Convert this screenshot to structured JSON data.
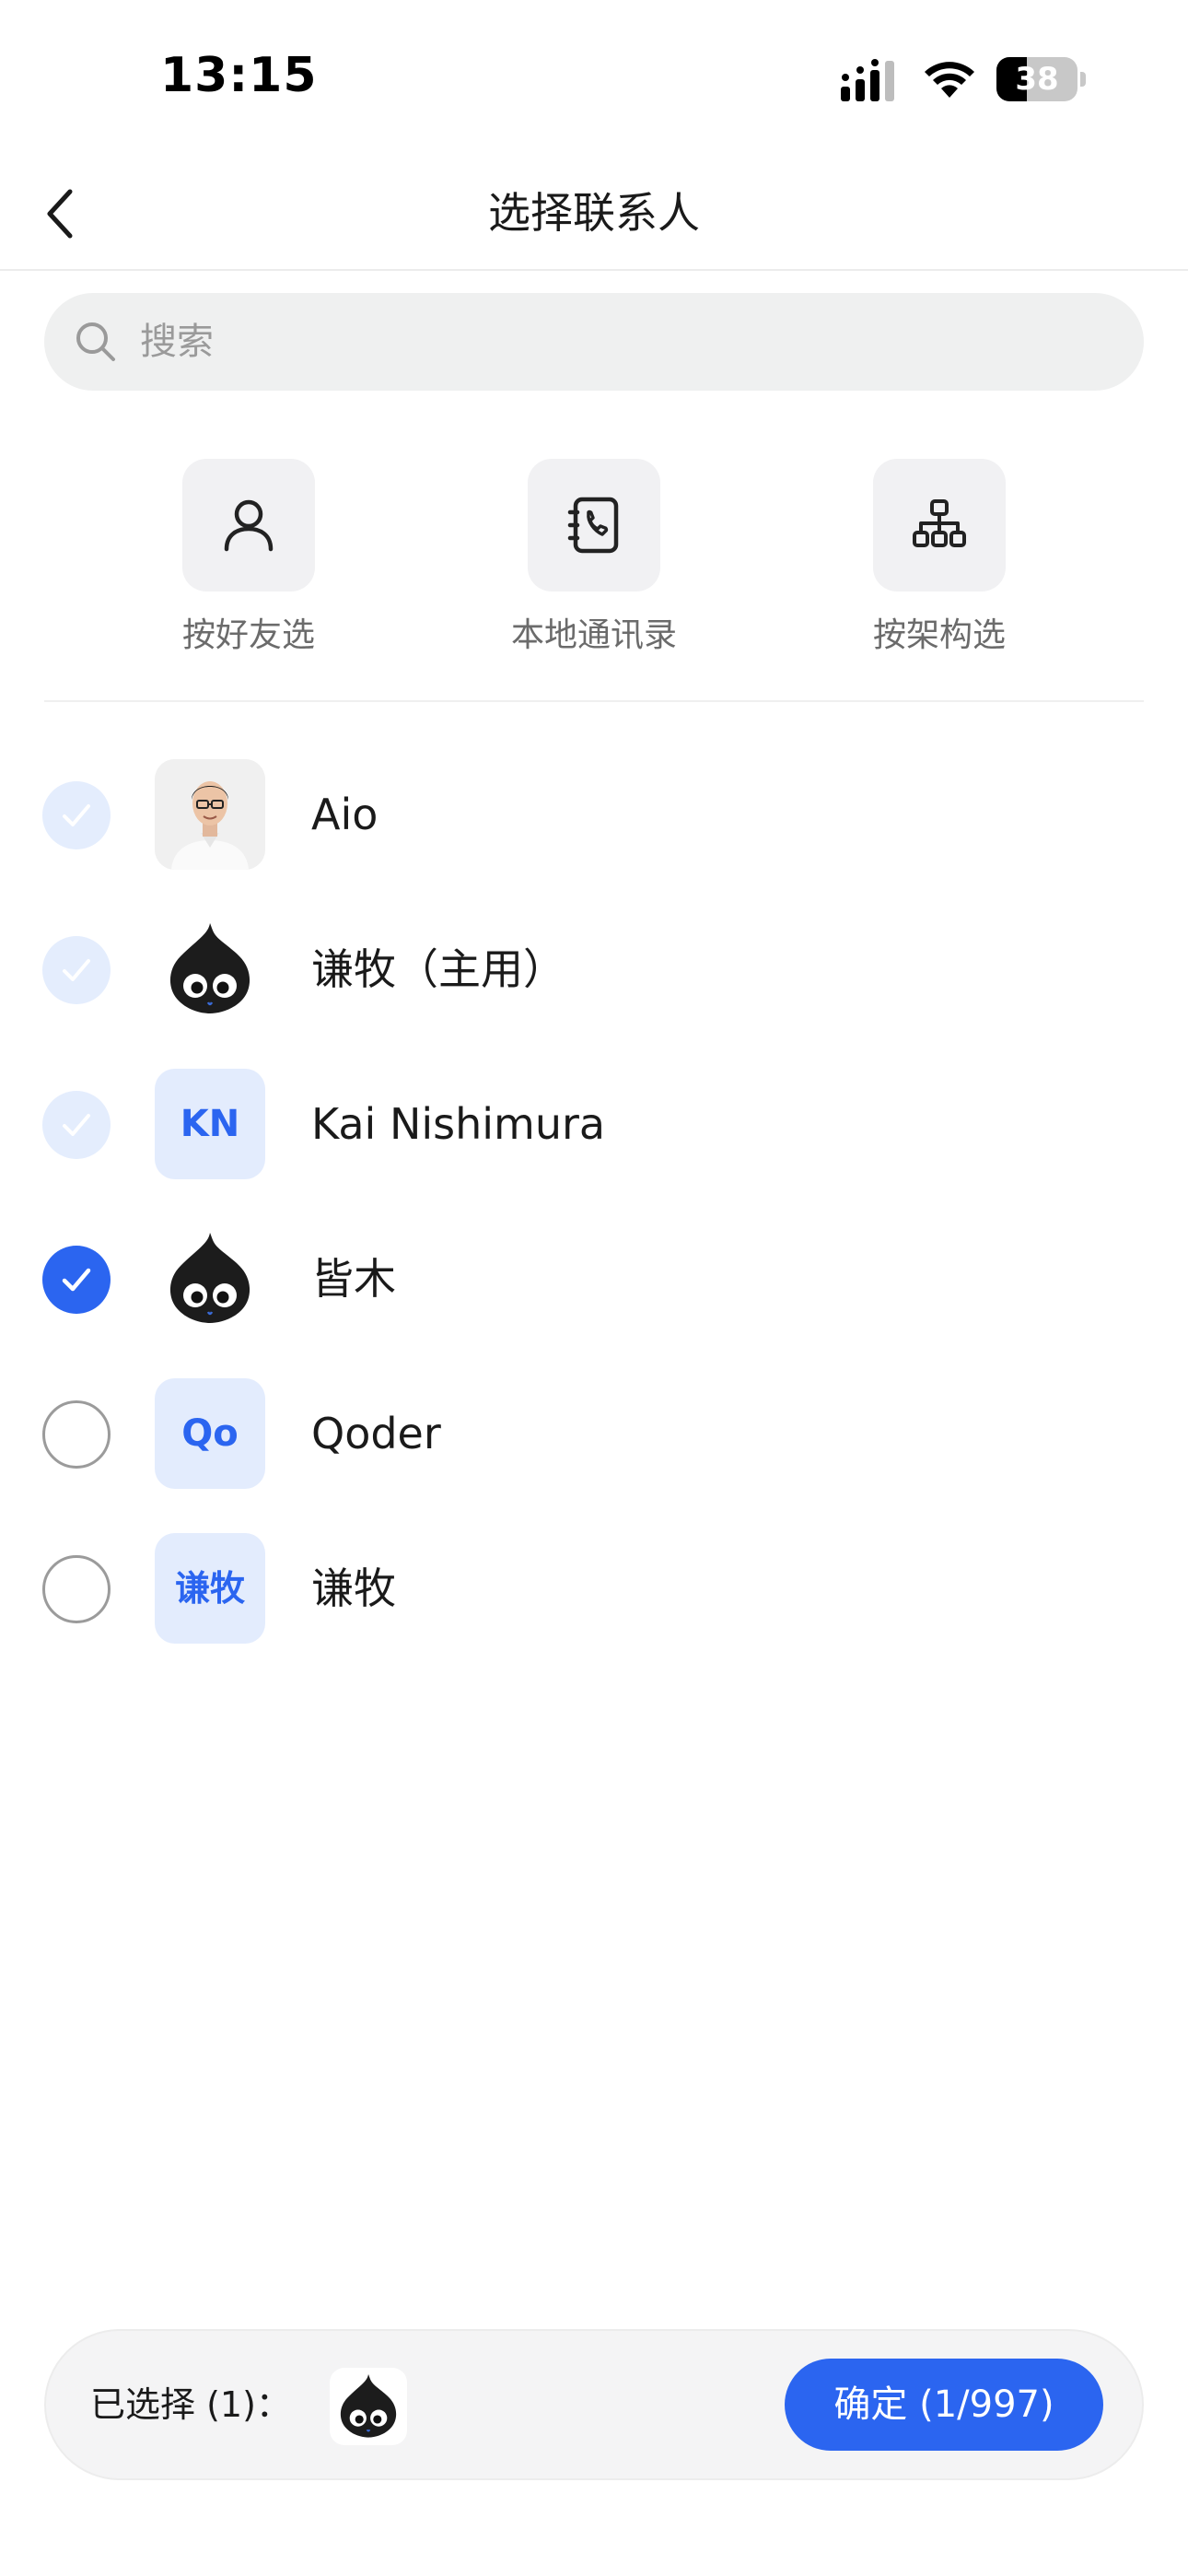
{
  "status_bar": {
    "time": "13:15",
    "battery_level": "38",
    "battery_fraction": 0.38
  },
  "nav": {
    "title": "选择联系人",
    "back_icon": "chevron-left-icon"
  },
  "search": {
    "placeholder": "搜索",
    "value": ""
  },
  "quick_select": [
    {
      "label": "按好友选",
      "icon": "person-icon"
    },
    {
      "label": "本地通讯录",
      "icon": "phone-book-icon"
    },
    {
      "label": "按架构选",
      "icon": "org-chart-icon"
    }
  ],
  "contacts": [
    {
      "name": "Aio",
      "avatar": "photo",
      "state": "locked"
    },
    {
      "name": "谦牧（主用）",
      "avatar": "mascot",
      "state": "locked"
    },
    {
      "name": "Kai Nishimura",
      "avatar": "initials",
      "initials": "KN",
      "state": "locked"
    },
    {
      "name": "皆木",
      "avatar": "mascot",
      "state": "checked"
    },
    {
      "name": "Qoder",
      "avatar": "initials",
      "initials": "Qo",
      "state": "unchecked"
    },
    {
      "name": "谦牧",
      "avatar": "initials",
      "initials": "谦牧",
      "state": "unchecked"
    }
  ],
  "footer": {
    "selected_label": "已选择 (1)：",
    "confirm_label": "确定 (1/997)"
  },
  "colors": {
    "accent": "#2b65f0",
    "accent_light": "#e3ecfd",
    "search_bg": "#eff0f0"
  }
}
